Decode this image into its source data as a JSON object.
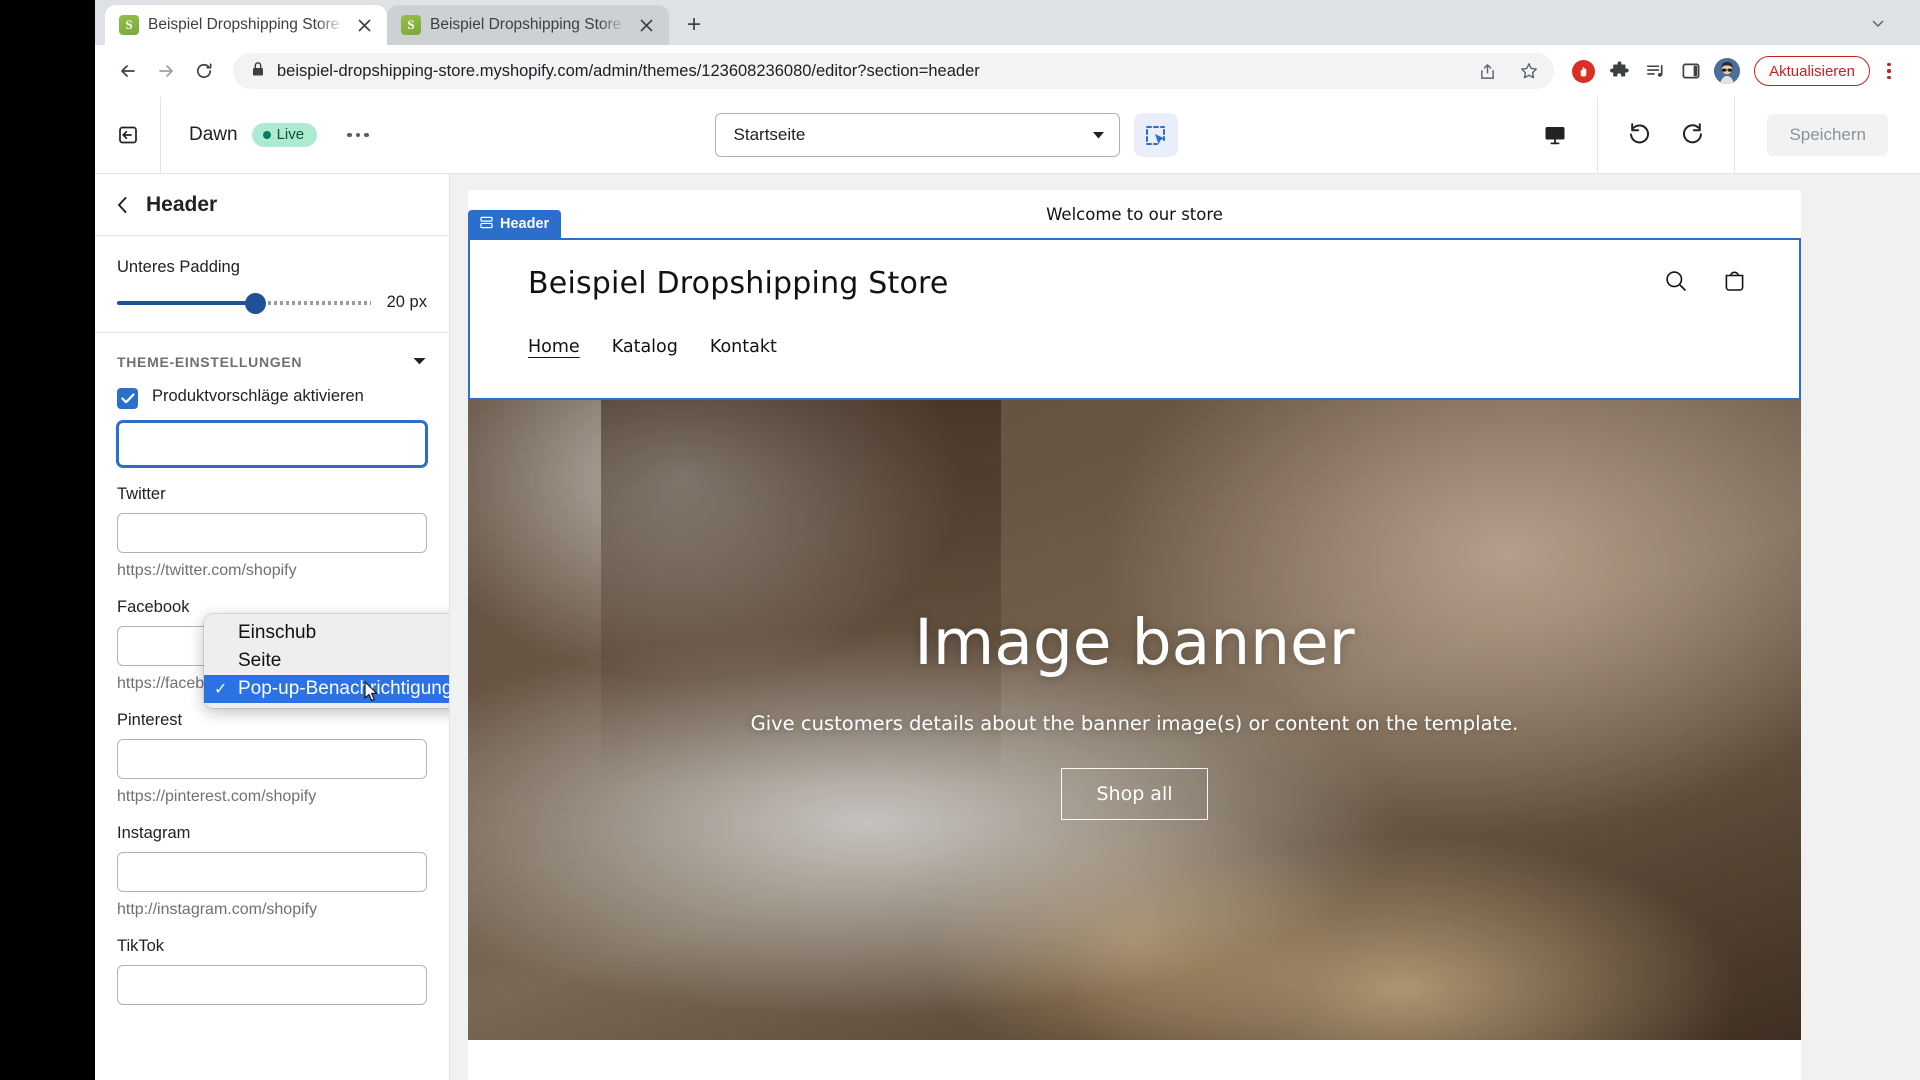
{
  "browser": {
    "tabs": [
      {
        "title": "Beispiel Dropshipping Store · D",
        "favicon": "shopify-icon",
        "active": true
      },
      {
        "title": "Beispiel Dropshipping Store · E",
        "favicon": "shopify-icon",
        "active": false
      }
    ],
    "new_tab_label": "+",
    "tab_list_chevron": "chevron-down-icon",
    "address": {
      "lock": "lock-icon",
      "url": "beispiel-dropshipping-store.myshopify.com/admin/themes/123608236080/editor?section=header",
      "share_icon": "share-icon",
      "bookmark_icon": "star-icon"
    },
    "extensions": {
      "adblock": "adblock-icon",
      "puzzle": "extensions-puzzle-icon",
      "playlist": "reading-list-icon",
      "sidepanel": "side-panel-icon",
      "avatar": "profile-avatar"
    },
    "update_button": "Aktualisieren",
    "menu_icon": "three-dot-menu-icon"
  },
  "editor": {
    "exit_icon": "exit-editor-icon",
    "theme_name": "Dawn",
    "status_badge": "Live",
    "more_actions": "more-actions-icon",
    "page_selector": {
      "value": "Startseite",
      "chevron": "chevron-down-icon"
    },
    "inspector_icon": "section-inspector-icon",
    "device_icon": "desktop-preview-icon",
    "undo_icon": "undo-icon",
    "redo_icon": "redo-icon",
    "save_label": "Speichern"
  },
  "sidebar": {
    "back_icon": "chevron-left-icon",
    "title": "Header",
    "padding_setting": {
      "label": "Unteres Padding",
      "value": "20 px",
      "percent": 55
    },
    "theme_settings": {
      "heading": "THEME-EINSTELLUNGEN",
      "collapse_icon": "chevron-down-icon",
      "checkbox": {
        "label": "Produktvorschläge aktivieren",
        "checked": true,
        "icon": "checkmark-icon"
      }
    },
    "dropdown": {
      "open": true,
      "options": [
        {
          "label": "Einschub",
          "selected": false
        },
        {
          "label": "Seite",
          "selected": false
        },
        {
          "label": "Pop-up-Benachrichtigung",
          "selected": true
        }
      ],
      "cursor": "mouse-pointer"
    },
    "social_fields": [
      {
        "label": "Twitter",
        "value": "",
        "help": "https://twitter.com/shopify"
      },
      {
        "label": "Facebook",
        "value": "",
        "help": "https://facebook.com/shopify"
      },
      {
        "label": "Pinterest",
        "value": "",
        "help": "https://pinterest.com/shopify"
      },
      {
        "label": "Instagram",
        "value": "",
        "help": "http://instagram.com/shopify"
      },
      {
        "label": "TikTok",
        "value": "",
        "help": ""
      }
    ]
  },
  "preview": {
    "announcement": "Welcome to our store",
    "section_tab": {
      "label": "Header",
      "icon": "section-grid-icon"
    },
    "store_title": "Beispiel Dropshipping Store",
    "nav": [
      {
        "label": "Home",
        "active": true
      },
      {
        "label": "Katalog",
        "active": false
      },
      {
        "label": "Kontakt",
        "active": false
      }
    ],
    "header_icons": {
      "search": "search-icon",
      "cart": "shopping-bag-icon"
    },
    "banner": {
      "heading": "Image banner",
      "subtext": "Give customers details about the banner image(s) or content on the template.",
      "button": "Shop all"
    }
  },
  "colors": {
    "accent_blue": "#2c6ecb",
    "select_highlight": "#2a72e5",
    "live_badge_bg": "#aee9d1",
    "live_badge_text": "#0c5132",
    "update_red": "#c5221f",
    "slider_blue": "#1f5199"
  }
}
